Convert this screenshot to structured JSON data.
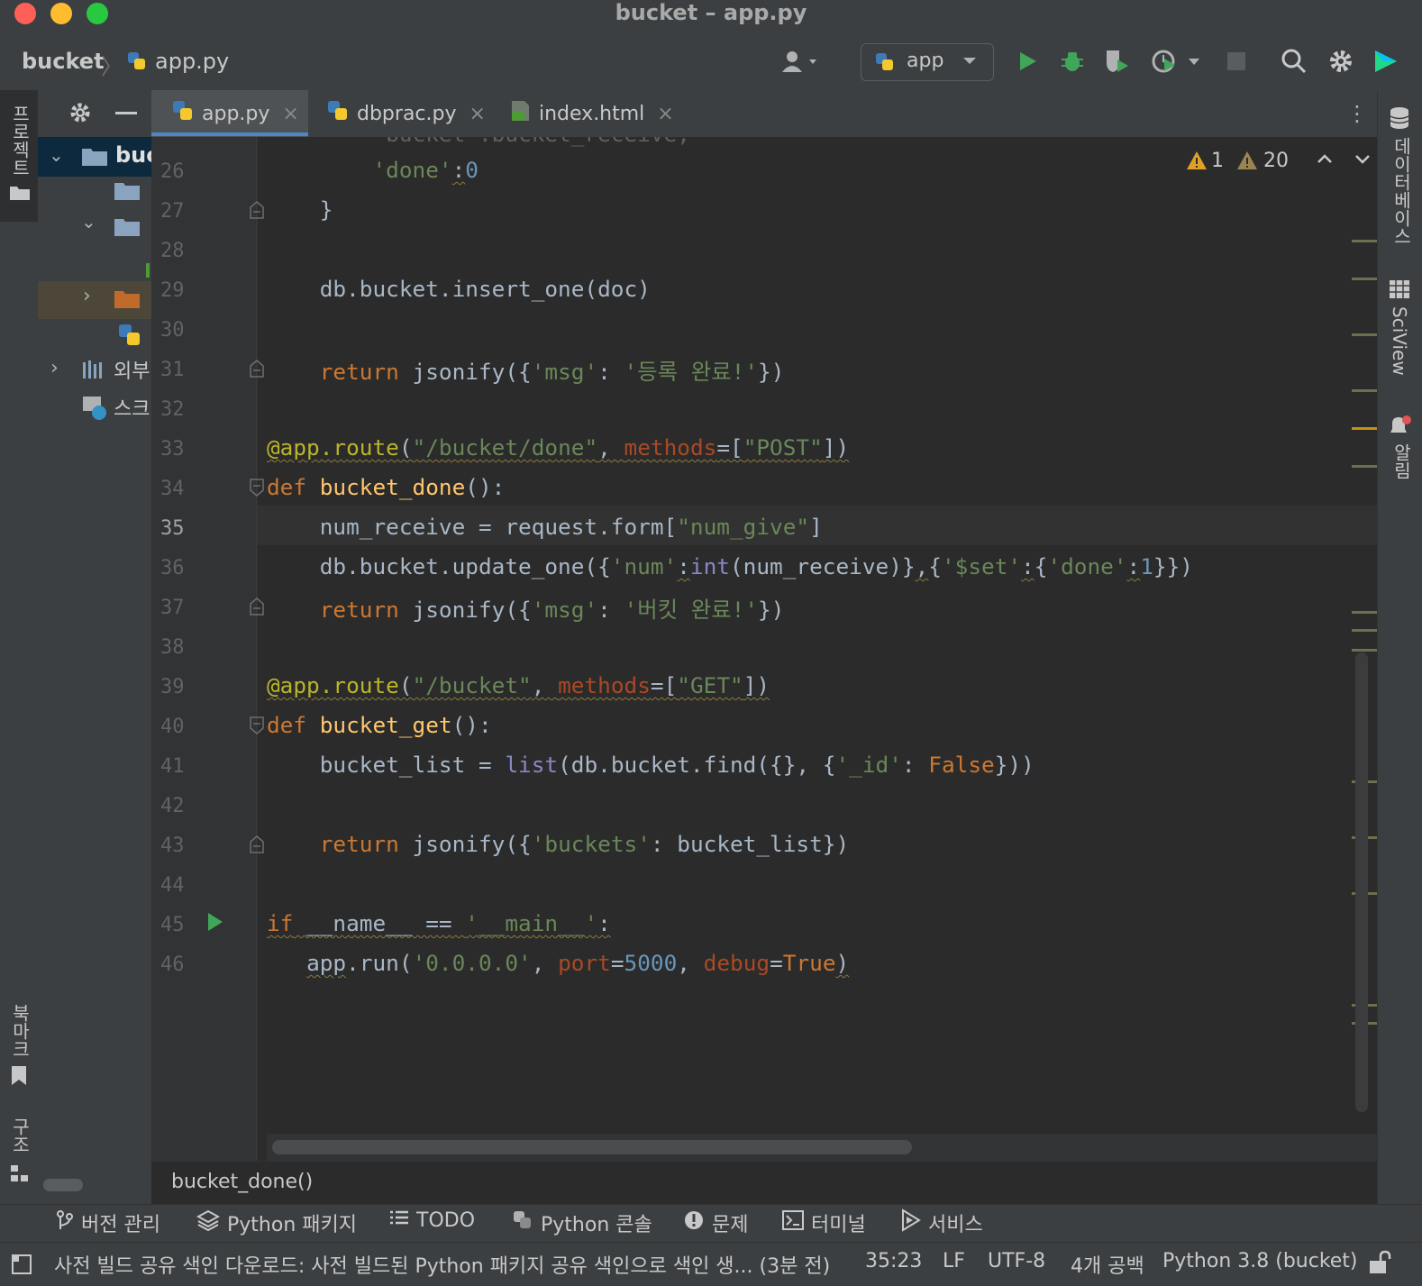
{
  "window": {
    "title": "bucket – app.py"
  },
  "breadcrumb": {
    "project": "bucket",
    "file": "app.py"
  },
  "run_config": {
    "label": "app"
  },
  "left_strip": {
    "project_label": "프로젝트",
    "bookmarks_label": "북마크",
    "structure_label": "구조"
  },
  "project_tree": {
    "root": "buc",
    "external": "외부",
    "scratches": "스크"
  },
  "tabs": [
    {
      "label": "app.py",
      "close": "×"
    },
    {
      "label": "dbprac.py",
      "close": "×"
    },
    {
      "label": "index.html",
      "close": "×"
    }
  ],
  "inspections": {
    "errors": "1",
    "warnings": "20"
  },
  "right_strip": {
    "database": "데이터베이스",
    "sciview": "SciView",
    "notifications": "알림"
  },
  "editor": {
    "current_line": "35",
    "lines": [
      {
        "n": "26",
        "text": "        'done':0"
      },
      {
        "n": "27",
        "text": "    }"
      },
      {
        "n": "28",
        "text": ""
      },
      {
        "n": "29",
        "text": "    db.bucket.insert_one(doc)"
      },
      {
        "n": "30",
        "text": ""
      },
      {
        "n": "31",
        "text": "    return jsonify({'msg': '등록 완료!'})"
      },
      {
        "n": "32",
        "text": ""
      },
      {
        "n": "33",
        "text": "@app.route(\"/bucket/done\", methods=[\"POST\"])"
      },
      {
        "n": "34",
        "text": "def bucket_done():"
      },
      {
        "n": "35",
        "text": "    num_receive = request.form[\"num_give\"]"
      },
      {
        "n": "36",
        "text": "    db.bucket.update_one({'num':int(num_receive)},{'$set':{'done':1}})"
      },
      {
        "n": "37",
        "text": "    return jsonify({'msg': '버킷 완료!'})"
      },
      {
        "n": "38",
        "text": ""
      },
      {
        "n": "39",
        "text": "@app.route(\"/bucket\", methods=[\"GET\"])"
      },
      {
        "n": "40",
        "text": "def bucket_get():"
      },
      {
        "n": "41",
        "text": "    bucket_list = list(db.bucket.find({}, {'_id': False}))"
      },
      {
        "n": "42",
        "text": ""
      },
      {
        "n": "43",
        "text": "    return jsonify({'buckets': bucket_list})"
      },
      {
        "n": "44",
        "text": ""
      },
      {
        "n": "45",
        "text": "if __name__ == '__main__':"
      },
      {
        "n": "46",
        "text": "   app.run('0.0.0.0', port=5000, debug=True)"
      }
    ]
  },
  "code_breadcrumb": "bucket_done()",
  "tool_windows": [
    {
      "label": "버전 관리",
      "icon": "vcs-branch-icon"
    },
    {
      "label": "Python 패키지",
      "icon": "layers-icon"
    },
    {
      "label": "TODO",
      "icon": "list-icon"
    },
    {
      "label": "Python 콘솔",
      "icon": "python-icon"
    },
    {
      "label": "문제",
      "icon": "info-icon"
    },
    {
      "label": "터미널",
      "icon": "terminal-icon"
    },
    {
      "label": "서비스",
      "icon": "play-circle-icon"
    }
  ],
  "status": {
    "message": "사전 빌드 공유 색인 다운로드: 사전 빌드된 Python 패키지 공유 색인으로 색인 생... (3분 전)",
    "position": "35:23",
    "line_sep": "LF",
    "encoding": "UTF-8",
    "indent": "4개 공백",
    "interpreter": "Python 3.8 (bucket)"
  },
  "colors": {
    "keyword": "#cc7832",
    "string": "#6a8759",
    "number": "#6897bb",
    "decorator": "#bbb529",
    "function": "#ffc66d"
  }
}
